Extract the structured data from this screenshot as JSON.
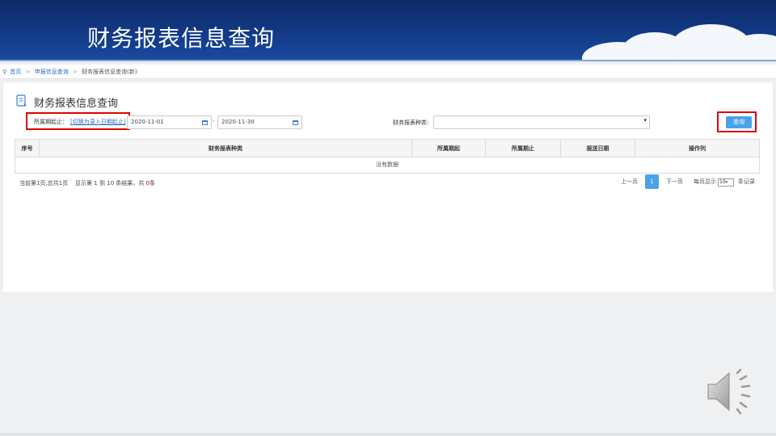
{
  "banner": {
    "title": "财务报表信息查询"
  },
  "breadcrumb": {
    "home": "首页",
    "sep1": ">",
    "level2": "申报信息查询",
    "sep2": ">",
    "current": "财务报表信息查询(新)"
  },
  "panel": {
    "title": "财务报表信息查询"
  },
  "filters": {
    "period_label": "所属期起止：",
    "switch_link": "[切换为录入日期起止]",
    "date_start": "2020-11-01",
    "dash": "-",
    "date_end": "2020-11-30",
    "type_label": "财务报表种类:",
    "type_value": "",
    "query_button": "查询"
  },
  "table": {
    "columns": [
      "序号",
      "财务报表种类",
      "所属期起",
      "所属期止",
      "报送日期",
      "操作列"
    ],
    "empty_text": "没有数据"
  },
  "pagination": {
    "summary": "当前第1页,总共1页",
    "display_prefix": "显示第 1 到 10 条结果，共",
    "total": "0",
    "display_suffix": "条",
    "prev": "上一页",
    "page": "1",
    "next": "下一页",
    "per_page_label": "每页显示",
    "per_page_value": "10",
    "per_page_suffix": "条记录"
  },
  "icons": {
    "speaker": "speaker-icon",
    "calendar": "calendar-icon",
    "location": "location-pin-icon",
    "document": "document-icon"
  },
  "colors": {
    "banner": "#123a86",
    "accent": "#4aa3e8",
    "highlight": "#e00000",
    "link": "#2a6fc0"
  }
}
